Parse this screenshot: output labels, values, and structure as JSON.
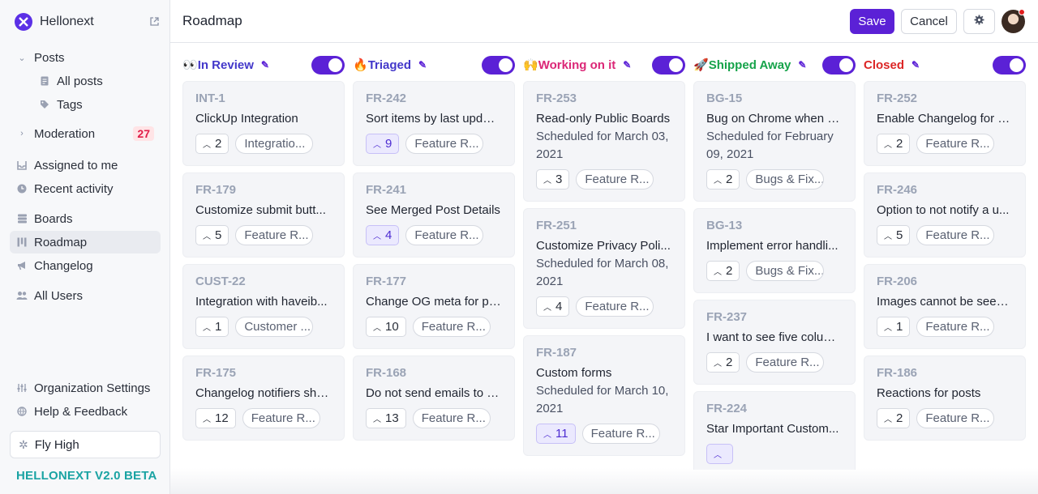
{
  "sidebar": {
    "brand": "Hellonext",
    "posts": {
      "label": "Posts",
      "all_posts": "All posts",
      "tags": "Tags"
    },
    "moderation": {
      "label": "Moderation",
      "count": "27"
    },
    "assigned": "Assigned to me",
    "recent": "Recent activity",
    "boards": "Boards",
    "roadmap": "Roadmap",
    "changelog": "Changelog",
    "all_users": "All Users",
    "org_settings": "Organization Settings",
    "help": "Help & Feedback",
    "fly_high": "Fly High",
    "version": "HELLONEXT V2.0 BETA"
  },
  "header": {
    "title": "Roadmap",
    "save": "Save",
    "cancel": "Cancel"
  },
  "columns": [
    {
      "emoji": "👀",
      "name": "In Review",
      "color": "#4338ca",
      "cards": [
        {
          "id": "INT-1",
          "title": "ClickUp Integration",
          "votes": "2",
          "tag": "Integratio..."
        },
        {
          "id": "FR-179",
          "title": "Customize submit butt...",
          "votes": "5",
          "tag": "Feature R..."
        },
        {
          "id": "CUST-22",
          "title": "Integration with haveib...",
          "votes": "1",
          "tag": "Customer ..."
        },
        {
          "id": "FR-175",
          "title": "Changelog notifiers sho...",
          "votes": "12",
          "tag": "Feature R..."
        }
      ]
    },
    {
      "emoji": "🔥",
      "name": "Triaged",
      "color": "#4338ca",
      "cards": [
        {
          "id": "FR-242",
          "title": "Sort items by last updat...",
          "votes": "9",
          "tag": "Feature R...",
          "voted": true
        },
        {
          "id": "FR-241",
          "title": "See Merged Post Details",
          "votes": "4",
          "tag": "Feature R...",
          "voted": true
        },
        {
          "id": "FR-177",
          "title": "Change OG meta for pu...",
          "votes": "10",
          "tag": "Feature R..."
        },
        {
          "id": "FR-168",
          "title": "Do not send emails to w...",
          "votes": "13",
          "tag": "Feature R..."
        }
      ]
    },
    {
      "emoji": "🙌",
      "name": "Working on it",
      "color": "#db2777",
      "cards": [
        {
          "id": "FR-253",
          "title": "Read-only Public Boards",
          "schedule": "Scheduled for March 03, 2021",
          "votes": "3",
          "tag": "Feature R..."
        },
        {
          "id": "FR-251",
          "title": "Customize Privacy Poli...",
          "schedule": "Scheduled for March 08, 2021",
          "votes": "4",
          "tag": "Feature R..."
        },
        {
          "id": "FR-187",
          "title": "Custom forms",
          "schedule": "Scheduled for March 10, 2021",
          "votes": "11",
          "tag": "Feature R...",
          "voted": true
        }
      ]
    },
    {
      "emoji": "🚀",
      "name": "Shipped Away",
      "color": "#16a34a",
      "cards": [
        {
          "id": "BG-15",
          "title": "Bug on Chrome when tr...",
          "schedule": "Scheduled for February 09, 2021",
          "votes": "2",
          "tag": "Bugs & Fix..."
        },
        {
          "id": "BG-13",
          "title": "Implement error handli...",
          "votes": "2",
          "tag": "Bugs & Fix..."
        },
        {
          "id": "FR-237",
          "title": "I want to see five colum...",
          "votes": "2",
          "tag": "Feature R..."
        },
        {
          "id": "FR-224",
          "title": "Star Important Custom...",
          "votes": "",
          "tag": "",
          "voted": true
        }
      ]
    },
    {
      "emoji": "",
      "name": "Closed",
      "color": "#dc2626",
      "cards": [
        {
          "id": "FR-252",
          "title": "Enable Changelog for P...",
          "votes": "2",
          "tag": "Feature R..."
        },
        {
          "id": "FR-246",
          "title": "Option to not notify a u...",
          "votes": "5",
          "tag": "Feature R..."
        },
        {
          "id": "FR-206",
          "title": "Images cannot be seen i...",
          "votes": "1",
          "tag": "Feature R..."
        },
        {
          "id": "FR-186",
          "title": "Reactions for posts",
          "votes": "2",
          "tag": "Feature R..."
        }
      ]
    }
  ]
}
